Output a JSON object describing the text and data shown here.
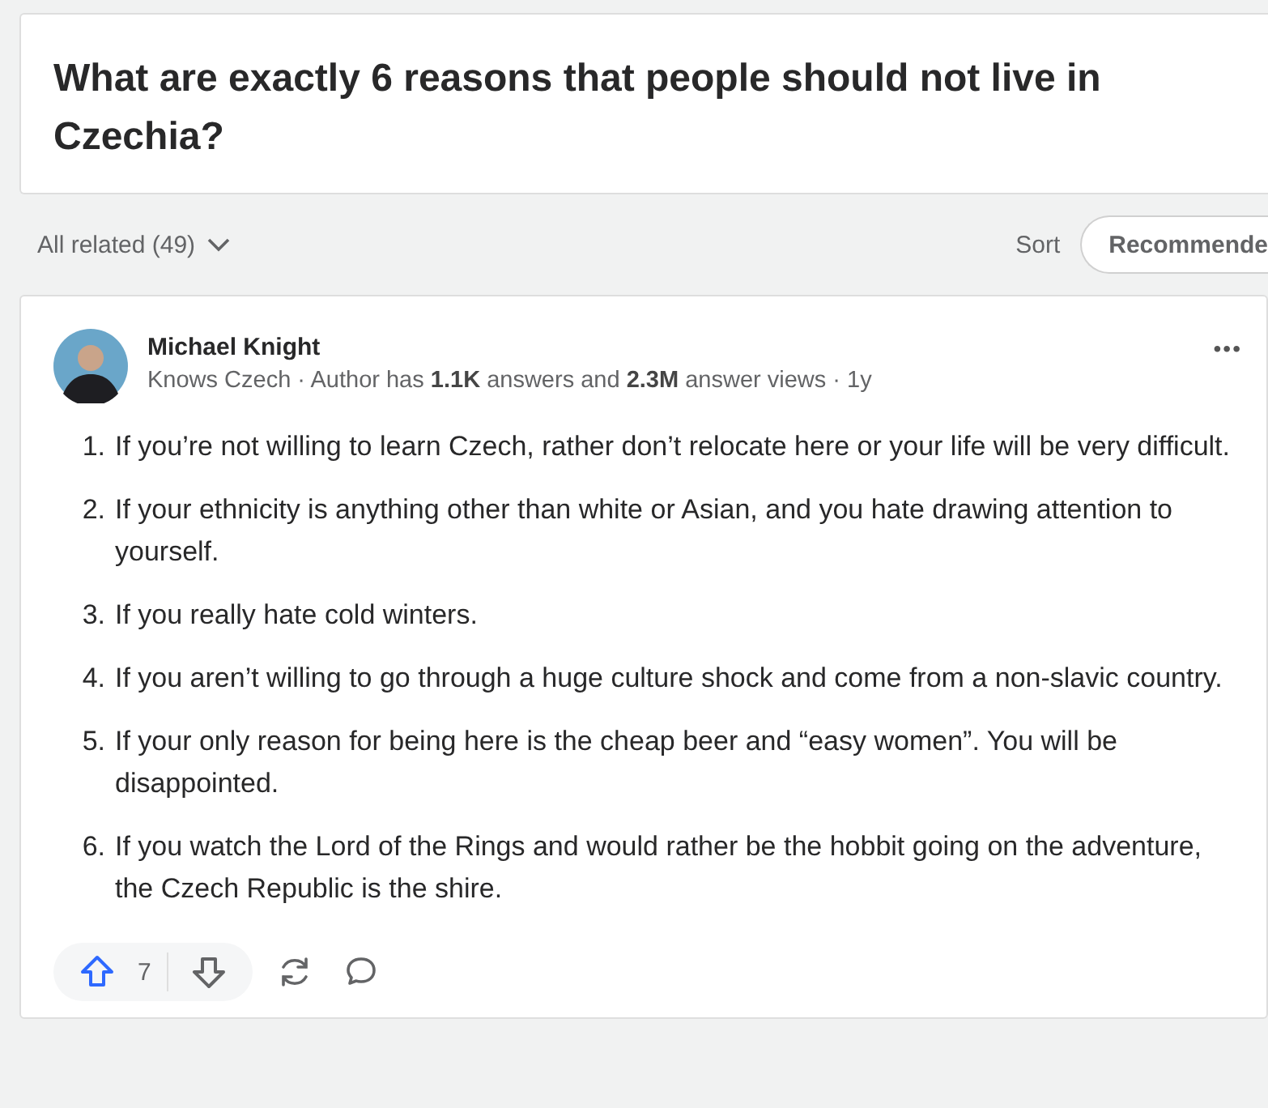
{
  "question": {
    "title": "What are exactly 6 reasons that people should not live in Czechia?"
  },
  "filter": {
    "label": "All related (49)",
    "sort_label": "Sort",
    "sort_value": "Recommende"
  },
  "answer": {
    "author": "Michael Knight",
    "meta": "Knows Czech · Author has **1.1K** answers and **2.3M** answer views · 1y",
    "more": "•••",
    "items": [
      {
        "number": "1.",
        "text": "If you’re not willing to learn Czech, rather don’t relocate here or your life will be very difficult."
      },
      {
        "number": "2.",
        "text": "If your ethnicity is anything other than white or Asian, and you hate drawing attention to yourself."
      },
      {
        "number": "3.",
        "text": "If you really hate cold winters."
      },
      {
        "number": "4.",
        "text": "If you aren’t willing to go through a huge culture shock and come from a non-slavic country."
      },
      {
        "number": "5.",
        "text": "If your only reason for being here is the cheap beer and “easy women”. You will be disappointed."
      },
      {
        "number": "6.",
        "text": "If you watch the Lord of the Rings and would rather be the hobbit going on the adventure, the Czech Republic is the shire."
      }
    ],
    "upvotes": "7"
  }
}
